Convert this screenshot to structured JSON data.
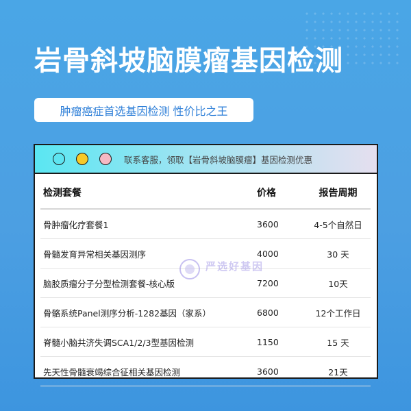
{
  "title": "岩骨斜坡脑膜瘤基因检测",
  "subtitle": "肿瘤癌症首选基因检测 性价比之王",
  "card": {
    "header_text": "联系客服，领取【岩骨斜坡脑膜瘤】基因检测优惠",
    "dot_colors": [
      "#5ee4f0",
      "#f7c928",
      "#f6b9c4"
    ]
  },
  "table": {
    "headers": [
      "检测套餐",
      "价格",
      "报告周期"
    ],
    "rows": [
      [
        "骨肿瘤化疗套餐1",
        "3600",
        "4-5个自然日"
      ],
      [
        "骨髓发育异常相关基因测序",
        "4000",
        "30 天"
      ],
      [
        "脑胶质瘤分子分型检测套餐-核心版",
        "7200",
        "10天"
      ],
      [
        "骨骼系统Panel测序分析-1282基因（家系）",
        "6800",
        "12个工作日"
      ],
      [
        "脊髓小脑共济失调SCA1/2/3型基因检测",
        "1150",
        "15 天"
      ],
      [
        "先天性骨髓衰竭综合征相关基因检测",
        "3600",
        "21天"
      ]
    ]
  },
  "watermark": {
    "text": "严选好基因"
  }
}
